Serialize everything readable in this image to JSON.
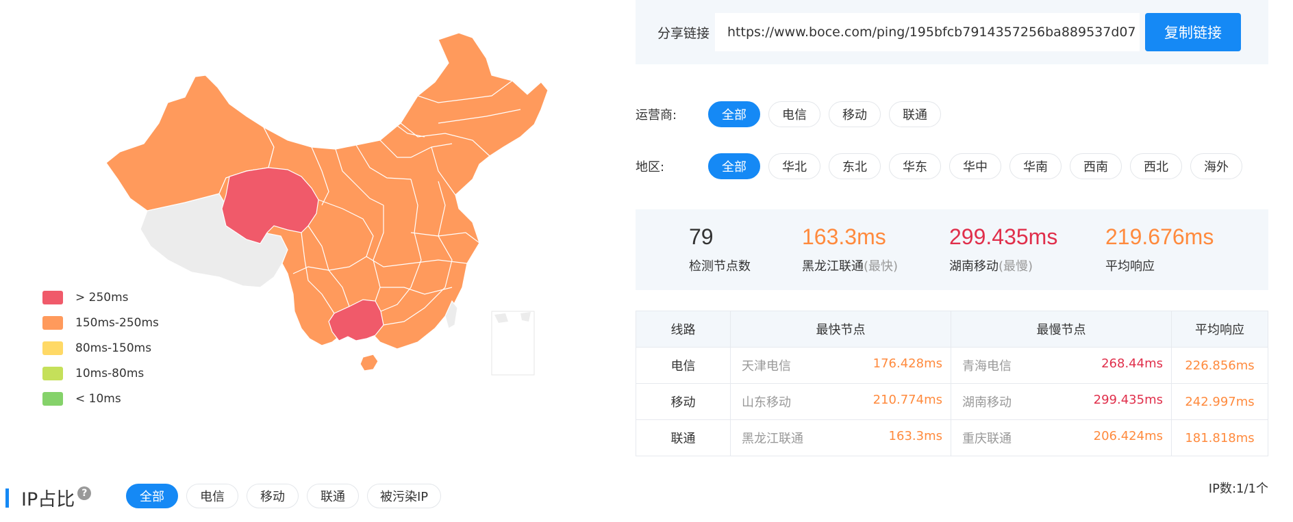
{
  "legend": [
    {
      "label": "> 250ms",
      "color": "#f05a6a"
    },
    {
      "label": "150ms-250ms",
      "color": "#ff9a5c"
    },
    {
      "label": "80ms-150ms",
      "color": "#ffd966"
    },
    {
      "label": "10ms-80ms",
      "color": "#c5e05a"
    },
    {
      "label": "< 10ms",
      "color": "#85d26a"
    }
  ],
  "share": {
    "label": "分享链接",
    "url": "https://www.boce.com/ping/195bfcb7914357256ba889537d07",
    "copy_label": "复制链接"
  },
  "filters": {
    "operator": {
      "label": "运营商:",
      "options": [
        "全部",
        "电信",
        "移动",
        "联通"
      ],
      "selected": "全部"
    },
    "region": {
      "label": "地区:",
      "options": [
        "全部",
        "华北",
        "东北",
        "华东",
        "华中",
        "华南",
        "西南",
        "西北",
        "海外"
      ],
      "selected": "全部"
    }
  },
  "stats": {
    "nodes": {
      "value": "79",
      "label": "检测节点数"
    },
    "fastest": {
      "value": "163.3ms",
      "label": "黑龙江联通",
      "note": "(最快)"
    },
    "slowest": {
      "value": "299.435ms",
      "label": "湖南移动",
      "note": "(最慢)"
    },
    "average": {
      "value": "219.676ms",
      "label": "平均响应"
    }
  },
  "table": {
    "headers": [
      "线路",
      "最快节点",
      "最慢节点",
      "平均响应"
    ],
    "rows": [
      {
        "route": "电信",
        "fast_node": "天津电信",
        "fast_ms": "176.428ms",
        "slow_node": "青海电信",
        "slow_ms": "268.44ms",
        "avg": "226.856ms"
      },
      {
        "route": "移动",
        "fast_node": "山东移动",
        "fast_ms": "210.774ms",
        "slow_node": "湖南移动",
        "slow_ms": "299.435ms",
        "avg": "242.997ms"
      },
      {
        "route": "联通",
        "fast_node": "黑龙江联通",
        "fast_ms": "163.3ms",
        "slow_node": "重庆联通",
        "slow_ms": "206.424ms",
        "avg": "181.818ms"
      }
    ]
  },
  "ip_count": "IP数:1/1个",
  "ip_section": {
    "title": "IP占比",
    "help": "?",
    "filters": [
      "全部",
      "电信",
      "移动",
      "联通",
      "被污染IP"
    ],
    "selected": "全部"
  },
  "colors": {
    "accent": "#1589f5",
    "map_normal": "#ff9a5c",
    "map_slow": "#f05a6a",
    "map_nodata": "#ececec"
  }
}
